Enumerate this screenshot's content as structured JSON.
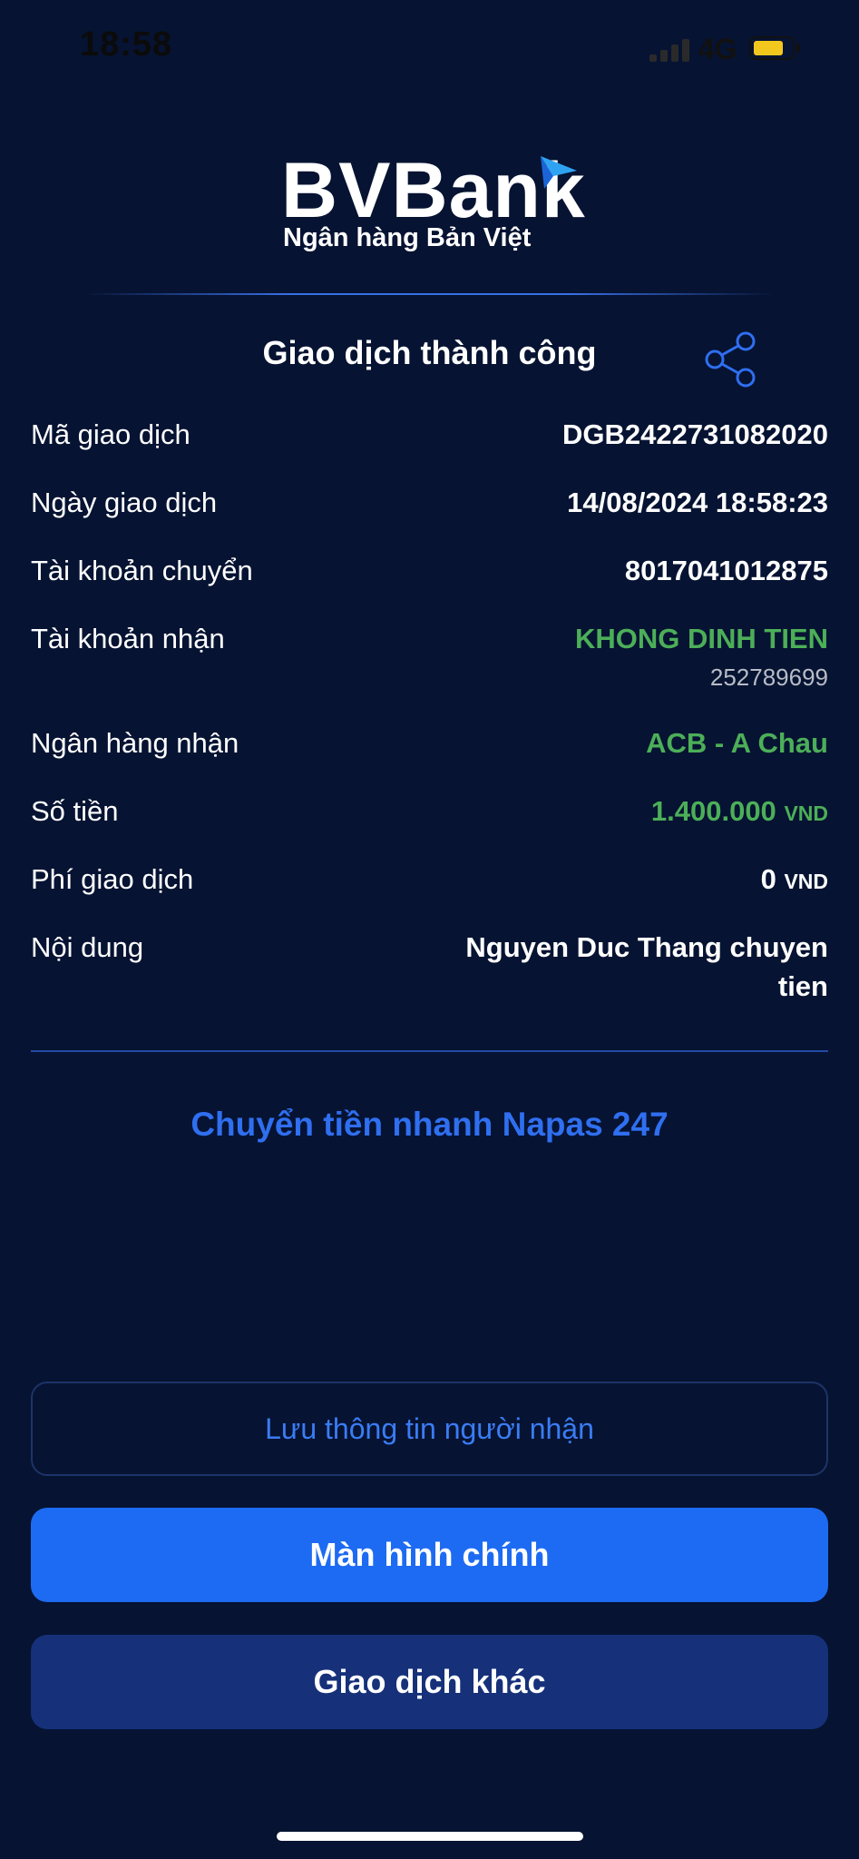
{
  "status_bar": {
    "time": "18:58",
    "network": "4G"
  },
  "brand": {
    "name": "BVBank",
    "tagline": "Ngân hàng Bản Việt"
  },
  "header": {
    "title": "Giao dịch thành công"
  },
  "details": {
    "transaction_id": {
      "label": "Mã giao dịch",
      "value": "DGB2422731082020"
    },
    "date": {
      "label": "Ngày giao dịch",
      "value": "14/08/2024 18:58:23"
    },
    "from_account": {
      "label": "Tài khoản chuyển",
      "value": "8017041012875"
    },
    "to_account": {
      "label": "Tài khoản nhận",
      "name": "KHONG DINH TIEN",
      "number": "252789699"
    },
    "bank": {
      "label": "Ngân hàng nhận",
      "value": "ACB - A Chau"
    },
    "amount": {
      "label": "Số tiền",
      "value": "1.400.000",
      "unit": "VND"
    },
    "fee": {
      "label": "Phí giao dịch",
      "value": "0",
      "unit": "VND"
    },
    "content": {
      "label": "Nội dung",
      "line1": "Nguyen Duc Thang chuyen",
      "line2": "tien"
    }
  },
  "service": {
    "name": "Chuyển tiền nhanh Napas 247"
  },
  "buttons": {
    "save_recipient": "Lưu thông tin người nhận",
    "home": "Màn hình chính",
    "other": "Giao dịch khác"
  },
  "colors": {
    "background": "#061332",
    "accent": "#1d6bf2",
    "success": "#4caf58",
    "secondary_button": "#16317a"
  }
}
